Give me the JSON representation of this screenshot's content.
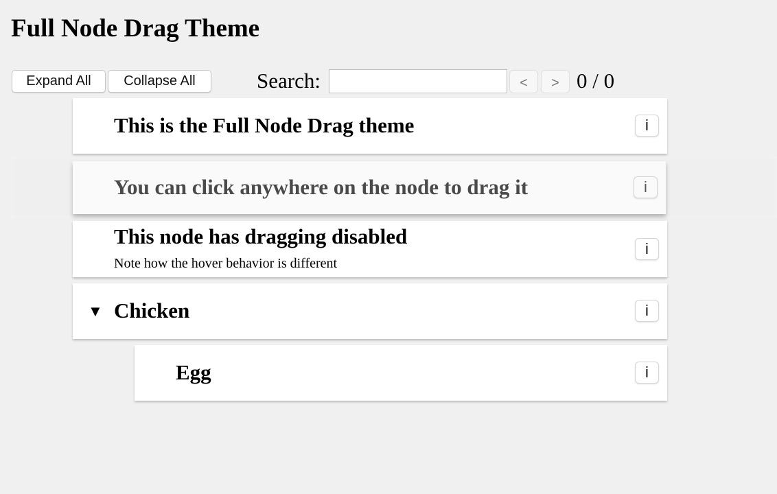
{
  "page": {
    "title": "Full Node Drag Theme"
  },
  "toolbar": {
    "expand_all_label": "Expand All",
    "collapse_all_label": "Collapse All",
    "search_label": "Search:",
    "search_value": "",
    "search_placeholder": "",
    "prev_label": "<",
    "next_label": ">",
    "match_count": "0 / 0"
  },
  "tree": {
    "info_label": "i",
    "nodes": [
      {
        "title": "This is the Full Node Drag theme",
        "subtitle": "",
        "depth": 0,
        "draggable": true,
        "hovered": false
      },
      {
        "title": "You can click anywhere on the node to drag it",
        "subtitle": "",
        "depth": 0,
        "draggable": true,
        "hovered": true
      },
      {
        "title": "This node has dragging disabled",
        "subtitle": "Note how the hover behavior is different",
        "depth": 0,
        "draggable": false,
        "hovered": false
      },
      {
        "title": "Chicken",
        "subtitle": "",
        "depth": 0,
        "draggable": true,
        "hovered": false,
        "expanded": true,
        "toggle_icon": "▼"
      },
      {
        "title": "Egg",
        "subtitle": "",
        "depth": 1,
        "draggable": true,
        "hovered": false
      }
    ]
  }
}
